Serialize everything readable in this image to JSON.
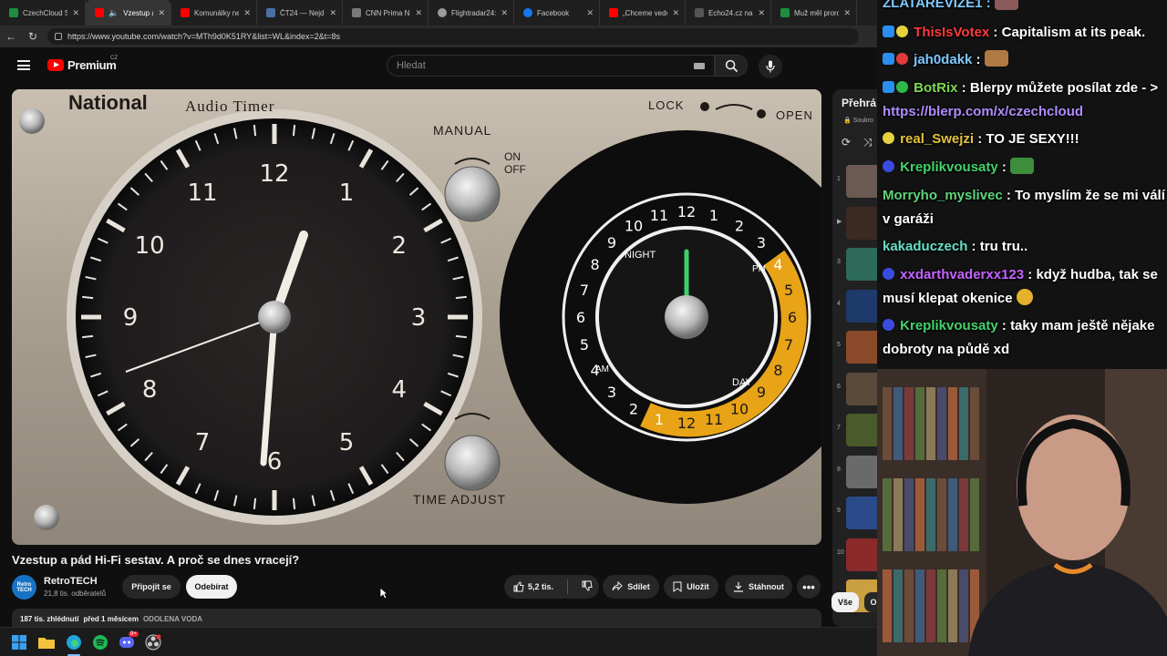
{
  "browser": {
    "tabs": [
      {
        "label": "CzechCloud St",
        "favicon_color": "#1e8e3e"
      },
      {
        "label": "Vzestup a p",
        "favicon_color": "#ff0000",
        "active": true
      },
      {
        "label": "Komunálky nebo",
        "favicon_color": "#ff0000"
      },
      {
        "label": "ČT24 — Nejdů",
        "favicon_color": "#4a6fa5"
      },
      {
        "label": "CNN Prima Ne",
        "favicon_color": "#7a7a7a"
      },
      {
        "label": "Flightradar24: L",
        "favicon_color": "#9a9a9a"
      },
      {
        "label": "Facebook",
        "favicon_color": "#1877f2"
      },
      {
        "label": "„Chceme veden",
        "favicon_color": "#ff0000"
      },
      {
        "label": "Echo24.cz na pl",
        "favicon_color": "#555555"
      },
      {
        "label": "Muž měl proro",
        "favicon_color": "#1e8e3e"
      }
    ],
    "url": "https://www.youtube.com/watch?v=MTh9d0K51RY&list=WL&index=2&t=8s"
  },
  "youtube": {
    "logo_text": "Premium",
    "region": "CZ",
    "search_placeholder": "Hledat",
    "video": {
      "clock_numbers": [
        "12",
        "1",
        "2",
        "3",
        "4",
        "5",
        "6",
        "7",
        "8",
        "9",
        "10",
        "11"
      ],
      "brand": "National",
      "model": "Audio Timer",
      "manual_label": "MANUAL",
      "on_label": "ON",
      "off_label": "OFF",
      "lock_label": "LOCK",
      "open_label": "OPEN",
      "time_adjust_label": "TIME ADJUST",
      "night_label": "NIGHT",
      "day_label": "DAY",
      "pm_label": "PM",
      "am_label": "AM"
    },
    "title": "Vzestup a pád Hi-Fi sestav. A proč se dnes vracejí?",
    "channel": {
      "name": "RetroTECH",
      "avatar_text": "Retro TECH",
      "subscribers": "21,8 tis. odběratelů",
      "join_label": "Připojit se",
      "subscribe_label": "Odebírat"
    },
    "actions": {
      "likes": "5,2 tis.",
      "share": "Sdílet",
      "save": "Uložit",
      "download": "Stáhnout"
    },
    "description": {
      "views": "187 tis. zhlédnutí",
      "date": "před 1 měsícem",
      "tag": "ODOLENA VODA"
    },
    "playlist": {
      "title": "Přehrá",
      "subtitle": "Soukro",
      "numbers": [
        "1",
        "",
        "3",
        "4",
        "5",
        "6",
        "7",
        "8",
        "9",
        "10",
        ""
      ],
      "thumb_colors": [
        "#6a5a52",
        "#3a2a22",
        "#2d6a5a",
        "#1e3a6a",
        "#8a4a2a",
        "#5a4a3a",
        "#4a5a2a",
        "#6a6a6a",
        "#2a4a8a",
        "#8a2a2a",
        "#caa040"
      ],
      "chip_all": "Vše",
      "chip_next": "O"
    }
  },
  "chat": {
    "top_name": "ZLATAREVIZE1",
    "messages": [
      {
        "user": "ThisIsVotex",
        "color": "#ff3b3b",
        "text": "Capitalism at its peak."
      },
      {
        "user": "jah0dakk",
        "color": "#7fc9ff",
        "text": ""
      },
      {
        "user": "BotRix",
        "color": "#7fd854",
        "text": "Blerpy můžete posílat zde - >",
        "link": "https://blerp.com/x/czechcloud"
      },
      {
        "user": "real_Swejzi",
        "color": "#e5c33d",
        "text": "TO JE SEXY!!!"
      },
      {
        "user": "Kreplikvousaty",
        "color": "#43d36b",
        "text": ""
      },
      {
        "user": "Morryho_myslivec",
        "color": "#5fd37a",
        "text": "To myslím že se mi válí v garáži"
      },
      {
        "user": "kakaduczech",
        "color": "#67e0c7",
        "text": "tru tru.."
      },
      {
        "user": "xxdarthvaderxx123",
        "color": "#c564ff",
        "text": "když hudba, tak se musí klepat okenice"
      },
      {
        "user": "Kreplikvousaty",
        "color": "#43d36b",
        "text": "taky mam ještě nějake dobroty na půdě xd"
      }
    ]
  },
  "taskbar": {
    "icons": [
      "windows-start-icon",
      "file-explorer-icon",
      "edge-icon",
      "spotify-icon",
      "discord-icon",
      "obs-icon"
    ],
    "discord_badge": "9+"
  },
  "colors": {
    "accent_red": "#ff0000",
    "background": "#0f0f0f",
    "chip_bg": "#272727",
    "timer_orange": "#e8a317"
  }
}
